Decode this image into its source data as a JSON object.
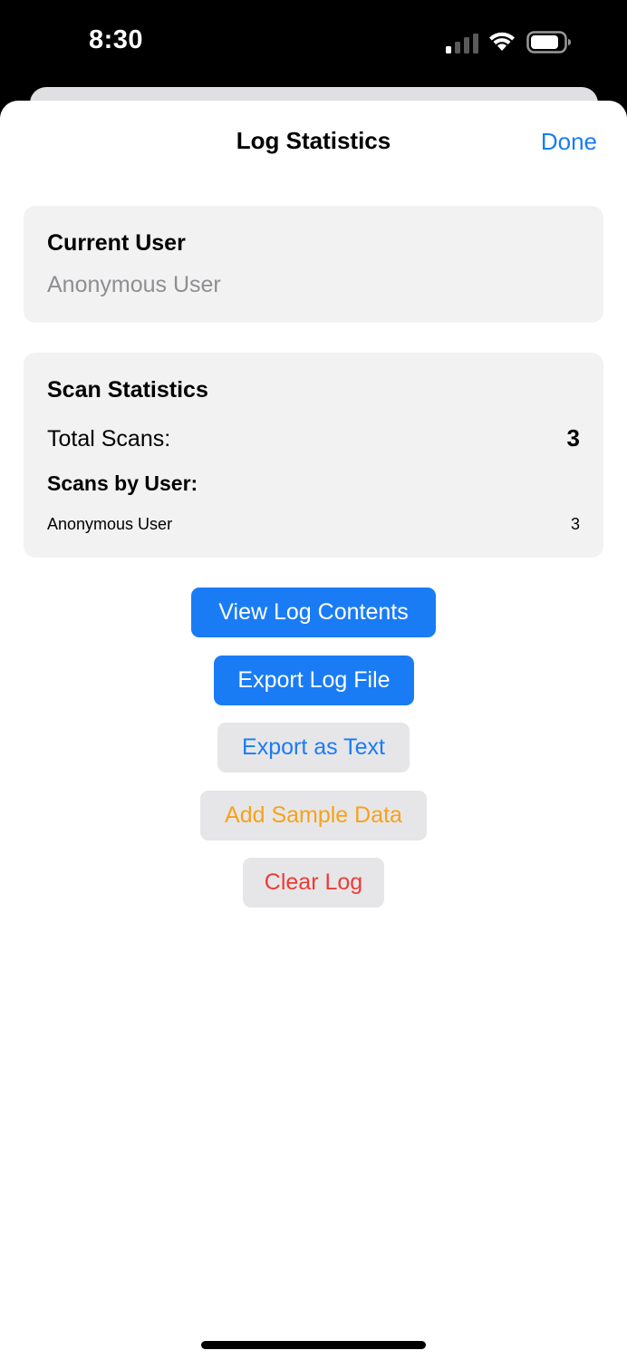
{
  "status_bar": {
    "time": "8:30",
    "icons": [
      "signal-icon",
      "wifi-icon",
      "battery-icon"
    ]
  },
  "nav": {
    "title": "Log Statistics",
    "done_label": "Done"
  },
  "current_user": {
    "heading": "Current User",
    "name": "Anonymous User"
  },
  "scan_statistics": {
    "heading": "Scan Statistics",
    "total_label": "Total Scans:",
    "total_value": "3",
    "by_user_label": "Scans by User:",
    "by_user": [
      {
        "user": "Anonymous User",
        "count": "3"
      }
    ]
  },
  "actions": {
    "view_log": "View Log Contents",
    "export_log": "Export Log File",
    "export_text": "Export as Text",
    "add_sample": "Add Sample Data",
    "clear_log": "Clear Log"
  },
  "colors": {
    "accent": "#1a7cf5",
    "warning": "#f7a21b",
    "destructive": "#ef3b35",
    "secondary_text": "#8e8e93",
    "card_background": "#f2f2f2"
  }
}
